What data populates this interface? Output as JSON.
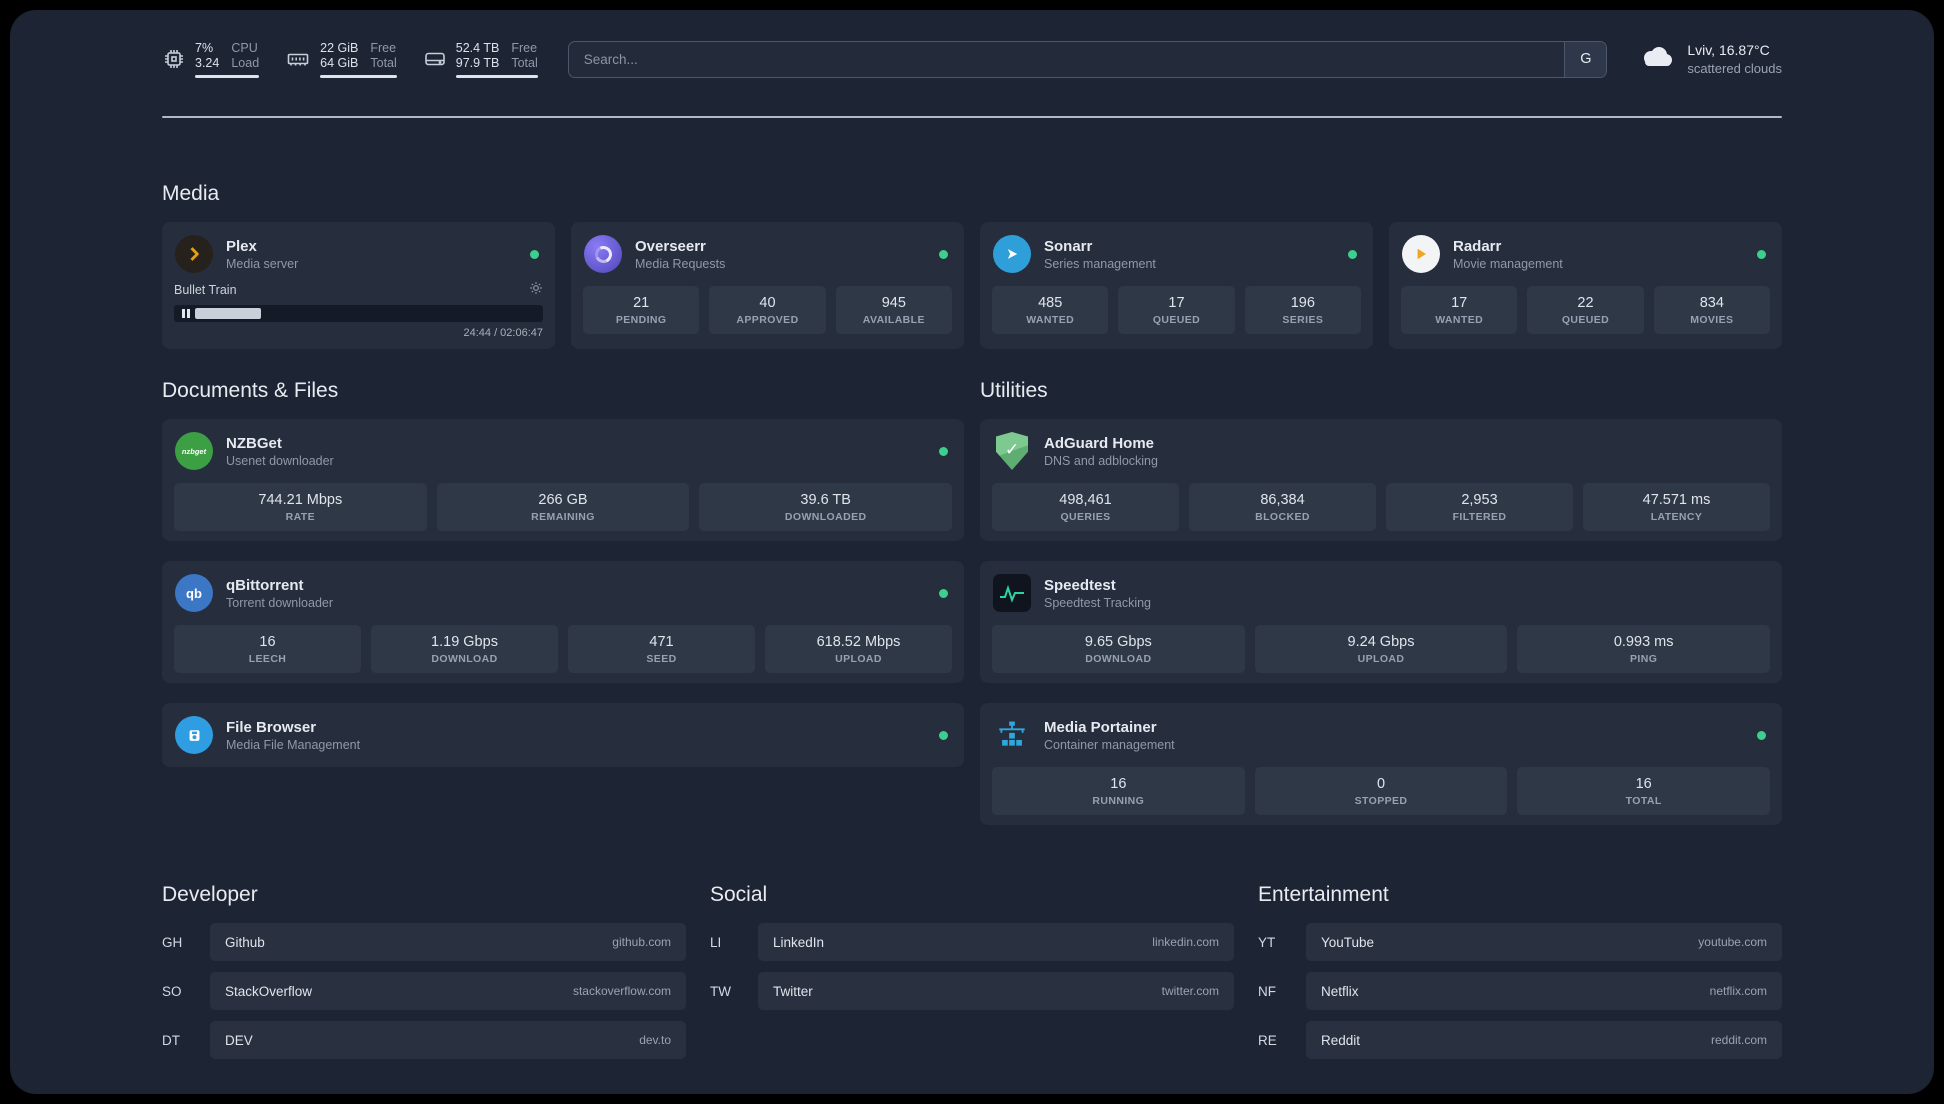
{
  "colors": {
    "status_online": "#3dcf8e",
    "background": "#1d2433",
    "card": "#262e3d",
    "accent_plex": "#e5a00d"
  },
  "topbar": {
    "resources": [
      {
        "icon": "cpu-icon",
        "value_top": "7%",
        "value_bottom": "3.24",
        "label_top": "CPU",
        "label_bottom": "Load"
      },
      {
        "icon": "memory-icon",
        "value_top": "22 GiB",
        "value_bottom": "64 GiB",
        "label_top": "Free",
        "label_bottom": "Total"
      },
      {
        "icon": "disk-icon",
        "value_top": "52.4 TB",
        "value_bottom": "97.9 TB",
        "label_top": "Free",
        "label_bottom": "Total"
      }
    ],
    "search": {
      "placeholder": "Search...",
      "provider_label": "G"
    },
    "weather": {
      "icon": "cloud-icon",
      "location": "Lviv, 16.87°C",
      "condition": "scattered clouds"
    }
  },
  "sections": {
    "media": "Media",
    "documents": "Documents & Files",
    "utilities": "Utilities",
    "developer": "Developer",
    "social": "Social",
    "entertainment": "Entertainment"
  },
  "services": {
    "plex": {
      "name": "Plex",
      "description": "Media server",
      "player": {
        "title": "Bullet Train",
        "time": "24:44 / 02:06:47",
        "progress_percent": 19
      }
    },
    "overseerr": {
      "name": "Overseerr",
      "description": "Media Requests",
      "stats": [
        {
          "value": "21",
          "label": "PENDING"
        },
        {
          "value": "40",
          "label": "APPROVED"
        },
        {
          "value": "945",
          "label": "AVAILABLE"
        }
      ]
    },
    "sonarr": {
      "name": "Sonarr",
      "description": "Series management",
      "stats": [
        {
          "value": "485",
          "label": "WANTED"
        },
        {
          "value": "17",
          "label": "QUEUED"
        },
        {
          "value": "196",
          "label": "SERIES"
        }
      ]
    },
    "radarr": {
      "name": "Radarr",
      "description": "Movie management",
      "stats": [
        {
          "value": "17",
          "label": "WANTED"
        },
        {
          "value": "22",
          "label": "QUEUED"
        },
        {
          "value": "834",
          "label": "MOVIES"
        }
      ]
    },
    "nzbget": {
      "name": "NZBGet",
      "description": "Usenet downloader",
      "stats": [
        {
          "value": "744.21 Mbps",
          "label": "RATE"
        },
        {
          "value": "266 GB",
          "label": "REMAINING"
        },
        {
          "value": "39.6 TB",
          "label": "DOWNLOADED"
        }
      ]
    },
    "qbittorrent": {
      "name": "qBittorrent",
      "description": "Torrent downloader",
      "stats": [
        {
          "value": "16",
          "label": "LEECH"
        },
        {
          "value": "1.19 Gbps",
          "label": "DOWNLOAD"
        },
        {
          "value": "471",
          "label": "SEED"
        },
        {
          "value": "618.52 Mbps",
          "label": "UPLOAD"
        }
      ]
    },
    "filebrowser": {
      "name": "File Browser",
      "description": "Media File Management"
    },
    "adguard": {
      "name": "AdGuard Home",
      "description": "DNS and adblocking",
      "stats": [
        {
          "value": "498,461",
          "label": "QUERIES"
        },
        {
          "value": "86,384",
          "label": "BLOCKED"
        },
        {
          "value": "2,953",
          "label": "FILTERED"
        },
        {
          "value": "47.571 ms",
          "label": "LATENCY"
        }
      ]
    },
    "speedtest": {
      "name": "Speedtest",
      "description": "Speedtest Tracking",
      "stats": [
        {
          "value": "9.65 Gbps",
          "label": "DOWNLOAD"
        },
        {
          "value": "9.24 Gbps",
          "label": "UPLOAD"
        },
        {
          "value": "0.993 ms",
          "label": "PING"
        }
      ]
    },
    "portainer": {
      "name": "Media Portainer",
      "description": "Container management",
      "stats": [
        {
          "value": "16",
          "label": "RUNNING"
        },
        {
          "value": "0",
          "label": "STOPPED"
        },
        {
          "value": "16",
          "label": "TOTAL"
        }
      ]
    }
  },
  "bookmarks": {
    "developer": [
      {
        "abbr": "GH",
        "name": "Github",
        "url": "github.com"
      },
      {
        "abbr": "SO",
        "name": "StackOverflow",
        "url": "stackoverflow.com"
      },
      {
        "abbr": "DT",
        "name": "DEV",
        "url": "dev.to"
      }
    ],
    "social": [
      {
        "abbr": "LI",
        "name": "LinkedIn",
        "url": "linkedin.com"
      },
      {
        "abbr": "TW",
        "name": "Twitter",
        "url": "twitter.com"
      }
    ],
    "entertainment": [
      {
        "abbr": "YT",
        "name": "YouTube",
        "url": "youtube.com"
      },
      {
        "abbr": "NF",
        "name": "Netflix",
        "url": "netflix.com"
      },
      {
        "abbr": "RE",
        "name": "Reddit",
        "url": "reddit.com"
      }
    ]
  }
}
